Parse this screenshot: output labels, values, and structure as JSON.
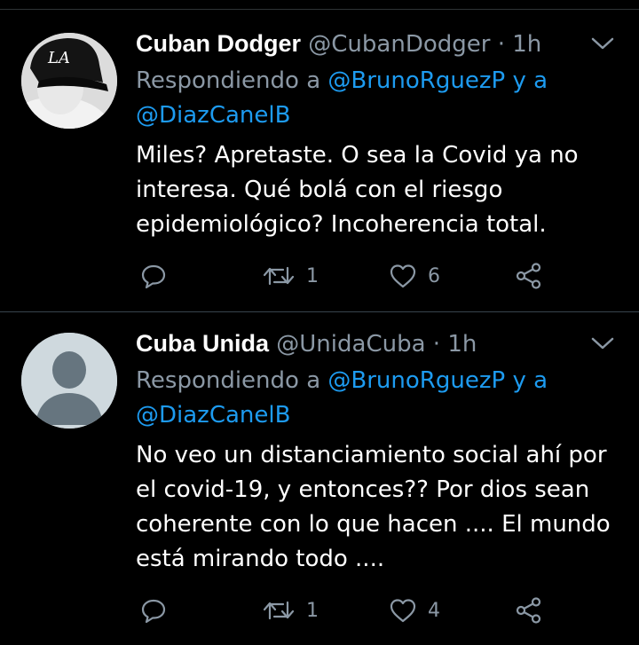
{
  "colors": {
    "background": "#000000",
    "name": "#ffffff",
    "secondary": "#8b98a5",
    "mention": "#1d9bf0",
    "divider": "#38444d"
  },
  "tweets": [
    {
      "name": "Cuban Dodger",
      "handle": "@CubanDodger",
      "separator": "·",
      "time": "1h",
      "replying_prefix": "Respondiendo a",
      "reply_to_1": "@BrunoRguezP",
      "reply_and": "y a",
      "reply_to_2": "@DiazCanelB",
      "text": "Miles? Apretaste. O sea la Covid ya no interesa. Qué bolá con el riesgo epidemiológico? Incoherencia total.",
      "retweets": "1",
      "likes": "6",
      "avatar_icon": "cap-photo-avatar"
    },
    {
      "name": "Cuba Unida",
      "handle": "@UnidaCuba",
      "separator": "·",
      "time": "1h",
      "replying_prefix": "Respondiendo a",
      "reply_to_1": "@BrunoRguezP",
      "reply_and": "y a",
      "reply_to_2": "@DiazCanelB",
      "text": "No veo un distanciamiento social ahí por el covid-19,  y entonces?? Por dios sean coherente con lo que hacen .... El mundo está mirando todo ....",
      "retweets": "1",
      "likes": "4",
      "avatar_icon": "default-profile-avatar"
    }
  ]
}
